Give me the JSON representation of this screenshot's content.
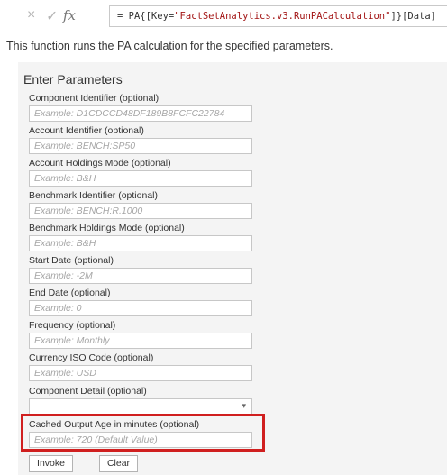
{
  "formula_bar": {
    "cancel_icon": "×",
    "commit_icon": "✓",
    "fx_label": "fx",
    "formula_prefix": "= PA{[Key=",
    "formula_string": "\"FactSetAnalytics.v3.RunPACalculation\"",
    "formula_suffix": "]}[Data]"
  },
  "description": "This function runs the PA calculation for the specified parameters.",
  "panel": {
    "title": "Enter Parameters",
    "params": [
      {
        "label": "Component Identifier (optional)",
        "placeholder": "Example: D1CDCCD48DF189B8FCFC22784"
      },
      {
        "label": "Account Identifier (optional)",
        "placeholder": "Example: BENCH:SP50"
      },
      {
        "label": "Account Holdings Mode (optional)",
        "placeholder": "Example: B&H"
      },
      {
        "label": "Benchmark Identifier (optional)",
        "placeholder": "Example: BENCH:R.1000"
      },
      {
        "label": "Benchmark Holdings Mode (optional)",
        "placeholder": "Example: B&H"
      },
      {
        "label": "Start Date (optional)",
        "placeholder": "Example: -2M"
      },
      {
        "label": "End Date (optional)",
        "placeholder": "Example: 0"
      },
      {
        "label": "Frequency (optional)",
        "placeholder": "Example: Monthly"
      },
      {
        "label": "Currency ISO Code (optional)",
        "placeholder": "Example: USD"
      }
    ],
    "component_detail": {
      "label": "Component Detail (optional)",
      "value": ""
    },
    "cached_output": {
      "label": "Cached Output Age in minutes (optional)",
      "placeholder": "Example: 720 (Default Value)"
    },
    "invoke_label": "Invoke",
    "clear_label": "Clear"
  },
  "colors": {
    "highlight": "#d01f1f",
    "panel_bg": "#f4f4f4",
    "string_literal": "#a31515"
  }
}
